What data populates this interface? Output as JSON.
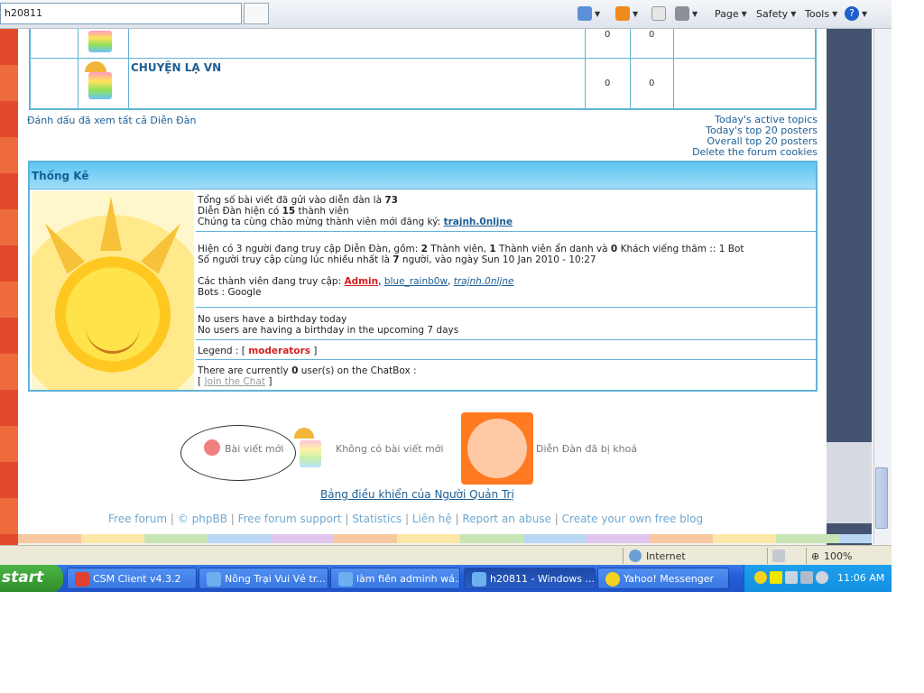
{
  "browser": {
    "address": "h20811",
    "toolbar": {
      "page": "Page",
      "safety": "Safety",
      "tools": "Tools"
    }
  },
  "forum_list": {
    "rows": [
      {
        "name": "",
        "topics": "0",
        "posts": "0"
      },
      {
        "name": "CHUYỆN LẠ VN",
        "topics": "0",
        "posts": "0"
      }
    ],
    "mark_read": "Đánh dấu đã xem tất cả Diễn Đàn",
    "right_links": [
      "Today's active topics",
      "Today's top 20 posters",
      "Overall top 20 posters",
      "Delete the forum cookies"
    ]
  },
  "stats": {
    "title": "Thống Kê",
    "total_posts_label": "Tổng số bài viết đã gửi vào diễn đàn là ",
    "total_posts": "73",
    "members_prefix": "Diễn Đàn hiện có ",
    "members_count": "15",
    "members_suffix": " thành viên",
    "newest_label": "Chúng ta cùng chào mừng thành viên mới đăng ký: ",
    "newest_member": "trajnh.0nljne",
    "online_line": {
      "p1": "Hiện có 3 người đang truy cập Diễn Đàn, gồm: ",
      "members": "2",
      "p2": " Thành viên, ",
      "hidden": "1",
      "p3": " Thành viên ẩn danh và ",
      "guests": "0",
      "p4": " Khách viếng thăm :: 1 Bot"
    },
    "record_line": {
      "p1": "Số người truy cập cùng lúc nhiều nhất là ",
      "count": "7",
      "p2": " người, vào ngày Sun 10 Jan 2010 - 10:27"
    },
    "online_members_label": "Các thành viên đang truy cập: ",
    "online_members": [
      "Admin",
      "blue_rainb0w",
      "trajnh.0nljne"
    ],
    "bots_label": "Bots : ",
    "bots": "Google",
    "birthday_today": "No users have a birthday today",
    "birthday_upcoming": "No users are having a birthday in the upcoming 7 days",
    "legend_label": "Legend : ",
    "legend_open": "[ ",
    "legend_item": "moderators",
    "legend_close": " ]",
    "chatbox_p1": "There are currently ",
    "chatbox_count": "0",
    "chatbox_p2": " user(s) on the ChatBox :",
    "join_chat_open": "[ ",
    "join_chat": "Join the Chat",
    "join_chat_close": " ]"
  },
  "legend": {
    "new_posts": "Bài viết mới",
    "no_new_posts": "Không có bài viết mới",
    "locked": "Diễn Đàn đã bị khoá"
  },
  "admin_panel": "Bảng điều khiển của Người Quản Trị",
  "footer": {
    "links": [
      "Free forum",
      "© phpBB",
      "Free forum support",
      "Statistics",
      "Liên hệ",
      "Report an abuse",
      "Create your own free blog"
    ],
    "separator": "|"
  },
  "statusbar": {
    "zone": "Internet",
    "zoom": "100%"
  },
  "taskbar": {
    "start": "start",
    "tasks": [
      "CSM Client v4.3.2",
      "Nông Trại Vui Vẻ tr...",
      "làm fiền adminh wá...",
      "h20811 - Windows ...",
      "Yahoo! Messenger"
    ],
    "clock": "11:06 AM"
  },
  "colors": {
    "accent": "#60b4d8",
    "link": "#1c5e95",
    "taskbar": "#245edb"
  }
}
